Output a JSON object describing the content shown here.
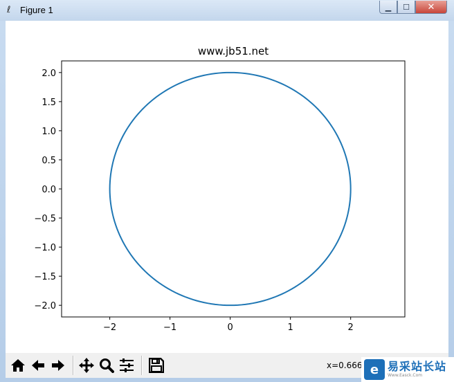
{
  "window": {
    "title": "Figure 1",
    "minimize_glyph": "▁",
    "maximize_glyph": "☐",
    "close_glyph": "✕"
  },
  "chart_data": {
    "type": "line",
    "title": "www.jb51.net",
    "xlabel": "",
    "ylabel": "",
    "xlim": [
      -2.8,
      2.9
    ],
    "ylim": [
      -2.2,
      2.2
    ],
    "x_ticks": [
      -2,
      -1,
      0,
      1,
      2
    ],
    "x_tick_labels": [
      "−2",
      "−1",
      "0",
      "1",
      "2"
    ],
    "y_ticks": [
      2.0,
      1.5,
      1.0,
      0.5,
      0.0,
      -0.5,
      -1.0,
      -1.5,
      -2.0
    ],
    "y_tick_labels": [
      "2.0",
      "1.5",
      "1.0",
      "0.5",
      "0.0",
      "−0.5",
      "−1.0",
      "−1.5",
      "−2.0"
    ],
    "grid": false,
    "series": [
      {
        "shape": "circle",
        "center": [
          0,
          0
        ],
        "radius": 2,
        "color": "#1f77b4"
      }
    ]
  },
  "toolbar": {
    "home_icon": "home-icon",
    "back_icon": "arrow-left-icon",
    "forward_icon": "arrow-right-icon",
    "pan_icon": "move-icon",
    "zoom_icon": "magnifier-icon",
    "configure_icon": "sliders-icon",
    "save_icon": "floppy-disk-icon",
    "coordinate_text": "x=0.6666"
  },
  "watermark": {
    "logo_glyph": "e",
    "main_text": "易采站长站",
    "sub_text": "Www.Easck.Com"
  }
}
